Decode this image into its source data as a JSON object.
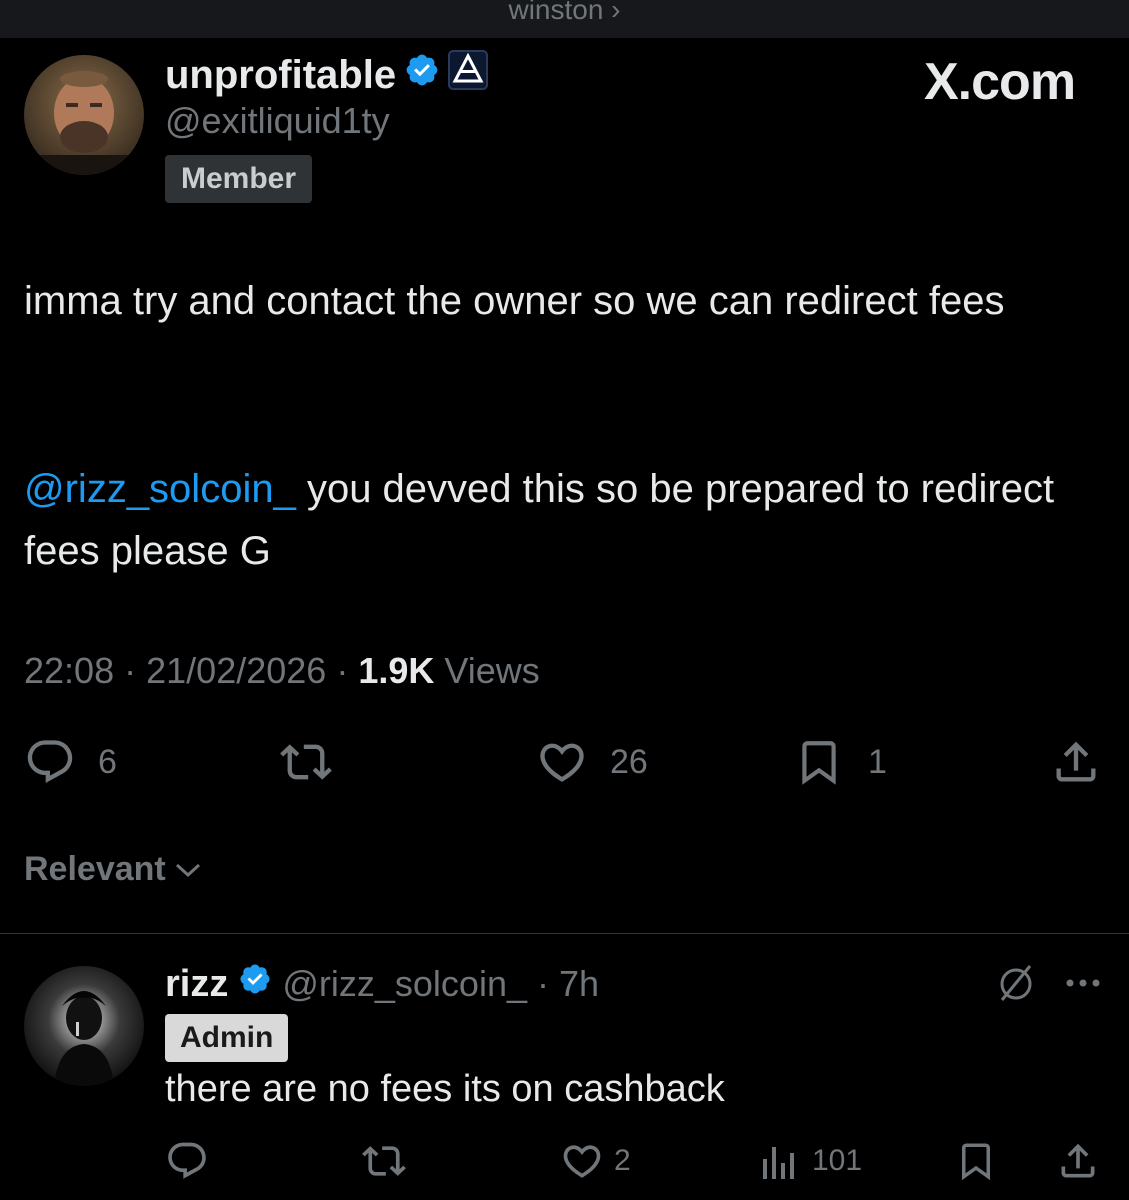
{
  "topbar": {
    "breadcrumb": "winston ›"
  },
  "post": {
    "display_name": "unprofitable",
    "handle": "@exitliquid1ty",
    "badge": "Member",
    "brand": "X.com",
    "text_line1": "imma try and contact the owner so we can redirect fees",
    "mention": "@rizz_solcoin_",
    "text_line2": " you devved this so be prepared to redirect fees please G",
    "time": "22:08",
    "date": "21/02/2026",
    "views_count": "1.9K",
    "views_label": "Views",
    "sep": "·",
    "replies": "6",
    "likes": "26",
    "bookmarks": "1"
  },
  "sort": {
    "label": "Relevant"
  },
  "reply": {
    "display_name": "rizz",
    "handle": "@rizz_solcoin_",
    "age": "· 7h",
    "badge": "Admin",
    "text": "there are no fees its on cashback",
    "likes": "2",
    "views": "101"
  },
  "colors": {
    "background": "#000000",
    "accent": "#1d9bf0",
    "muted": "#71767b",
    "text": "#e7e9ea"
  }
}
